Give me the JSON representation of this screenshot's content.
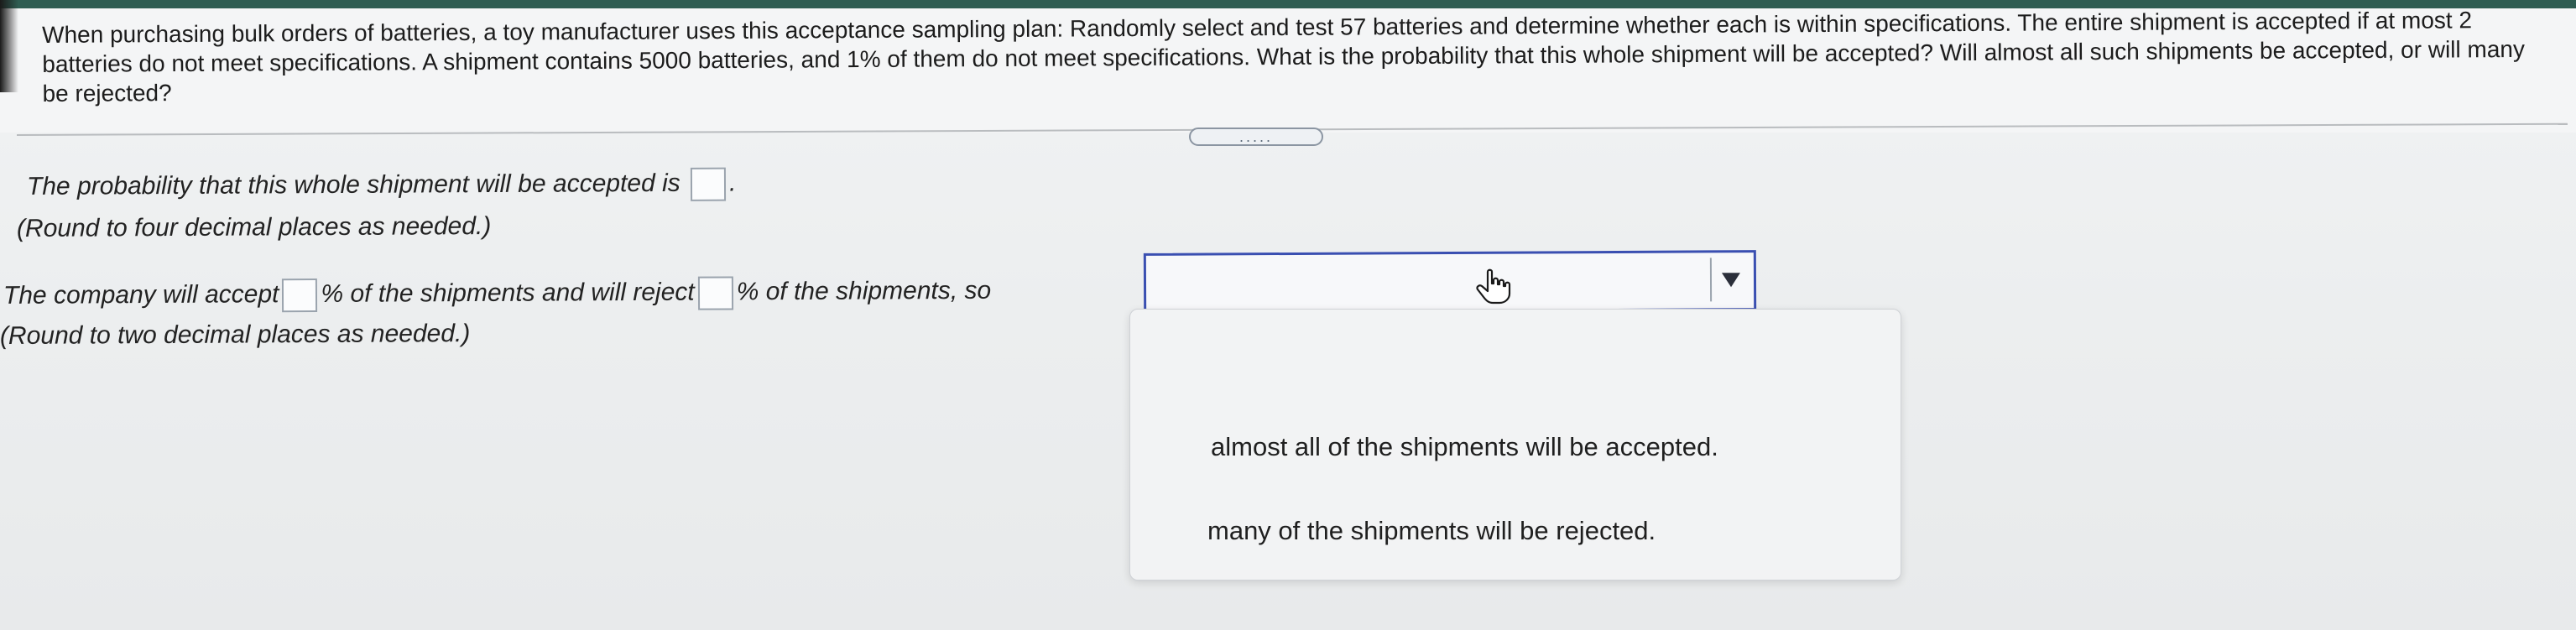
{
  "question": {
    "text": "When purchasing bulk orders of batteries, a toy manufacturer uses this acceptance sampling plan: Randomly select and test 57 batteries and determine whether each is within specifications. The entire shipment is accepted if at most 2 batteries do not meet specifications. A shipment contains 5000 batteries, and 1% of them do not meet specifications. What is the probability that this whole shipment will be accepted? Will almost all such shipments be accepted, or will many be rejected?"
  },
  "expand_handle_glyph": ".....",
  "part1": {
    "prompt": "The probability that this whole shipment will be accepted is",
    "end_punct": ".",
    "note": "(Round to four decimal places as needed.)"
  },
  "part2": {
    "prefix": "The company will accept",
    "middle": "% of the shipments and will reject",
    "suffix": "% of the shipments, so",
    "note": "(Round to two decimal places as needed.)"
  },
  "dropdown": {
    "selected": "",
    "options": [
      "almost all of the shipments will be accepted.",
      "many of the shipments will be rejected."
    ]
  },
  "colors": {
    "accent_border": "#3a4fb1",
    "top_strip": "#2f5d52"
  },
  "icons": {
    "cursor": "hand-pointer-icon",
    "dropdown_arrow": "triangle-down-icon",
    "expand": "ellipsis-handle-icon"
  }
}
